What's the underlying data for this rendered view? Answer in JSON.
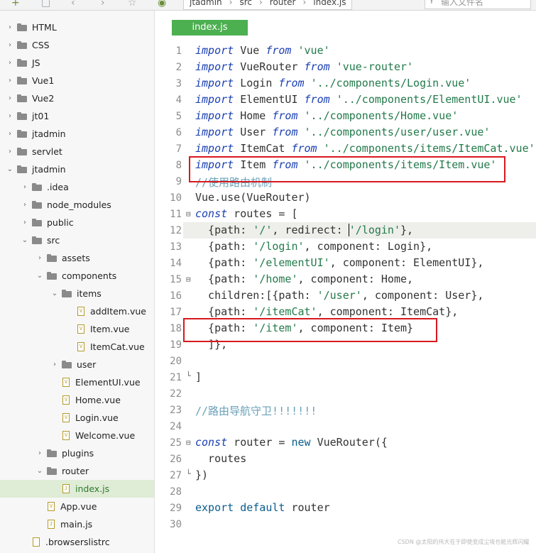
{
  "toolbar": {
    "crumbs": [
      "jtadmin",
      "src",
      "router",
      "index.js"
    ],
    "search_placeholder": "输入文件名"
  },
  "sidebar": {
    "items": [
      {
        "label": "HTML",
        "type": "folder",
        "expanded": false,
        "depth": 0
      },
      {
        "label": "CSS",
        "type": "folder",
        "expanded": false,
        "depth": 0
      },
      {
        "label": "JS",
        "type": "folder",
        "expanded": false,
        "depth": 0
      },
      {
        "label": "Vue1",
        "type": "folder",
        "expanded": false,
        "depth": 0
      },
      {
        "label": "Vue2",
        "type": "folder",
        "expanded": false,
        "depth": 0
      },
      {
        "label": "jt01",
        "type": "folder",
        "expanded": false,
        "depth": 0
      },
      {
        "label": "jtadmin",
        "type": "folder",
        "expanded": false,
        "depth": 0
      },
      {
        "label": "servlet",
        "type": "folder",
        "expanded": false,
        "depth": 0
      },
      {
        "label": "jtadmin",
        "type": "folder",
        "expanded": true,
        "depth": 0
      },
      {
        "label": ".idea",
        "type": "folder",
        "expanded": false,
        "depth": 1
      },
      {
        "label": "node_modules",
        "type": "folder",
        "expanded": false,
        "depth": 1
      },
      {
        "label": "public",
        "type": "folder",
        "expanded": false,
        "depth": 1
      },
      {
        "label": "src",
        "type": "folder",
        "expanded": true,
        "depth": 1
      },
      {
        "label": "assets",
        "type": "folder",
        "expanded": false,
        "depth": 2
      },
      {
        "label": "components",
        "type": "folder",
        "expanded": true,
        "depth": 2
      },
      {
        "label": "items",
        "type": "folder",
        "expanded": true,
        "depth": 3
      },
      {
        "label": "addItem.vue",
        "type": "vue",
        "depth": 4
      },
      {
        "label": "Item.vue",
        "type": "vue",
        "depth": 4
      },
      {
        "label": "ItemCat.vue",
        "type": "vue",
        "depth": 4
      },
      {
        "label": "user",
        "type": "folder",
        "expanded": false,
        "depth": 3
      },
      {
        "label": "ElementUI.vue",
        "type": "vue",
        "depth": 3
      },
      {
        "label": "Home.vue",
        "type": "vue",
        "depth": 3
      },
      {
        "label": "Login.vue",
        "type": "vue",
        "depth": 3
      },
      {
        "label": "Welcome.vue",
        "type": "vue",
        "depth": 3
      },
      {
        "label": "plugins",
        "type": "folder",
        "expanded": false,
        "depth": 2
      },
      {
        "label": "router",
        "type": "folder",
        "expanded": true,
        "depth": 2
      },
      {
        "label": "index.js",
        "type": "js",
        "depth": 3,
        "selected": true
      },
      {
        "label": "App.vue",
        "type": "vue",
        "depth": 2
      },
      {
        "label": "main.js",
        "type": "js",
        "depth": 2
      },
      {
        "label": ".browserslistrc",
        "type": "file",
        "depth": 1
      }
    ]
  },
  "editor": {
    "tab_label": "index.js",
    "lines": [
      [
        [
          "kw",
          "import"
        ],
        [
          "plain",
          " Vue "
        ],
        [
          "kw",
          "from"
        ],
        [
          "plain",
          " "
        ],
        [
          "str",
          "'vue'"
        ]
      ],
      [
        [
          "kw",
          "import"
        ],
        [
          "plain",
          " VueRouter "
        ],
        [
          "kw",
          "from"
        ],
        [
          "plain",
          " "
        ],
        [
          "str",
          "'vue-router'"
        ]
      ],
      [
        [
          "kw",
          "import"
        ],
        [
          "plain",
          " Login "
        ],
        [
          "kw",
          "from"
        ],
        [
          "plain",
          " "
        ],
        [
          "str",
          "'../components/Login.vue'"
        ]
      ],
      [
        [
          "kw",
          "import"
        ],
        [
          "plain",
          " ElementUI "
        ],
        [
          "kw",
          "from"
        ],
        [
          "plain",
          " "
        ],
        [
          "str",
          "'../components/ElementUI.vue'"
        ]
      ],
      [
        [
          "kw",
          "import"
        ],
        [
          "plain",
          " Home "
        ],
        [
          "kw",
          "from"
        ],
        [
          "plain",
          " "
        ],
        [
          "str",
          "'../components/Home.vue'"
        ]
      ],
      [
        [
          "kw",
          "import"
        ],
        [
          "plain",
          " User "
        ],
        [
          "kw",
          "from"
        ],
        [
          "plain",
          " "
        ],
        [
          "str",
          "'../components/user/user.vue'"
        ]
      ],
      [
        [
          "kw",
          "import"
        ],
        [
          "plain",
          " ItemCat "
        ],
        [
          "kw",
          "from"
        ],
        [
          "plain",
          " "
        ],
        [
          "str",
          "'../components/items/ItemCat.vue'"
        ]
      ],
      [
        [
          "kw",
          "import"
        ],
        [
          "plain",
          " Item "
        ],
        [
          "kw",
          "from"
        ],
        [
          "plain",
          " "
        ],
        [
          "str",
          "'../components/items/Item.vue'"
        ]
      ],
      [
        [
          "cmt",
          "//使用路由机制"
        ]
      ],
      [
        [
          "plain",
          "Vue.use(VueRouter)"
        ]
      ],
      [
        [
          "kw",
          "const"
        ],
        [
          "plain",
          " routes = ["
        ]
      ],
      [
        [
          "plain",
          "  {path: "
        ],
        [
          "str",
          "'/'"
        ],
        [
          "plain",
          ", redirect: "
        ],
        [
          "str",
          "'/login'"
        ],
        [
          "plain",
          "},"
        ]
      ],
      [
        [
          "plain",
          "  {path: "
        ],
        [
          "str",
          "'/login'"
        ],
        [
          "plain",
          ", component: Login},"
        ]
      ],
      [
        [
          "plain",
          "  {path: "
        ],
        [
          "str",
          "'/elementUI'"
        ],
        [
          "plain",
          ", component: ElementUI},"
        ]
      ],
      [
        [
          "plain",
          "  {path: "
        ],
        [
          "str",
          "'/home'"
        ],
        [
          "plain",
          ", component: Home,"
        ]
      ],
      [
        [
          "plain",
          "  children:[{path: "
        ],
        [
          "str",
          "'/user'"
        ],
        [
          "plain",
          ", component: User},"
        ]
      ],
      [
        [
          "plain",
          "  {path: "
        ],
        [
          "str",
          "'/itemCat'"
        ],
        [
          "plain",
          ", component: ItemCat},"
        ]
      ],
      [
        [
          "plain",
          "  {path: "
        ],
        [
          "str",
          "'/item'"
        ],
        [
          "plain",
          ", component: Item}"
        ]
      ],
      [
        [
          "plain",
          "  ]},"
        ]
      ],
      [
        [
          "plain",
          ""
        ]
      ],
      [
        [
          "plain",
          "]"
        ]
      ],
      [
        [
          "plain",
          ""
        ]
      ],
      [
        [
          "cmt",
          "//路由导航守卫!!!!!!!"
        ]
      ],
      [
        [
          "plain",
          ""
        ]
      ],
      [
        [
          "kw",
          "const"
        ],
        [
          "plain",
          " router = "
        ],
        [
          "kw2",
          "new"
        ],
        [
          "plain",
          " VueRouter({"
        ]
      ],
      [
        [
          "plain",
          "  routes"
        ]
      ],
      [
        [
          "plain",
          "})"
        ]
      ],
      [
        [
          "plain",
          ""
        ]
      ],
      [
        [
          "kw2",
          "export default"
        ],
        [
          "plain",
          " router"
        ]
      ],
      [
        [
          "plain",
          ""
        ]
      ]
    ],
    "line_numbers": [
      "1",
      "2",
      "3",
      "4",
      "5",
      "6",
      "7",
      "8",
      "9",
      "10",
      "11",
      "12",
      "13",
      "14",
      "15",
      "16",
      "17",
      "18",
      "19",
      "20",
      "21",
      "22",
      "23",
      "24",
      "25",
      "26",
      "27",
      "28",
      "29",
      "30"
    ]
  },
  "watermark": "CSDN @太阳的伟大在于即使变成尘埃也能光辉闪耀"
}
